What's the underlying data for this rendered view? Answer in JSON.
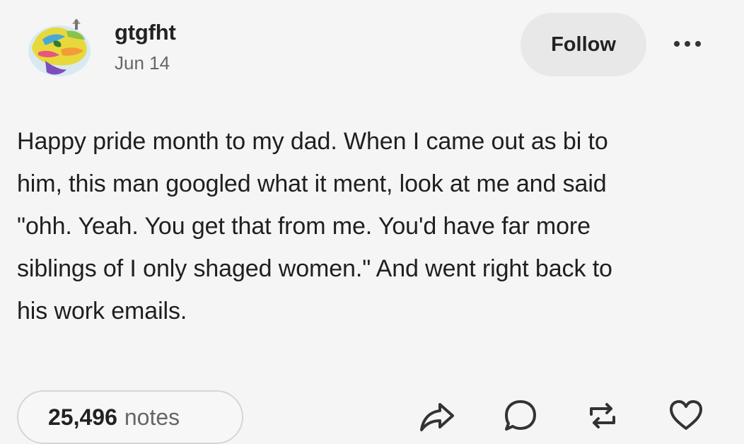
{
  "post": {
    "author": {
      "username": "gtgfht",
      "date": "Jun 14",
      "avatar_icon": "rainbow-toy-avatar"
    },
    "follow_label": "Follow",
    "more_icon": "ellipsis-icon",
    "body_lines": [
      "Happy pride month to my dad. When I came out as bi to",
      "him, this man googled what it ment, look at me and said",
      "\"ohh. Yeah. You get that from me. You'd have far more",
      "siblings of I only shaged women.\" And went right back to",
      "his work emails."
    ],
    "footer": {
      "notes_count": "25,496",
      "notes_label": "notes",
      "actions": [
        "share-icon",
        "reply-icon",
        "reblog-icon",
        "like-icon"
      ]
    }
  },
  "colors": {
    "background": "#f5f5f5",
    "text": "#1f1f1f",
    "muted": "#666666",
    "follow_bg": "#e8e8e8",
    "pill_border": "#d6d6d6"
  }
}
